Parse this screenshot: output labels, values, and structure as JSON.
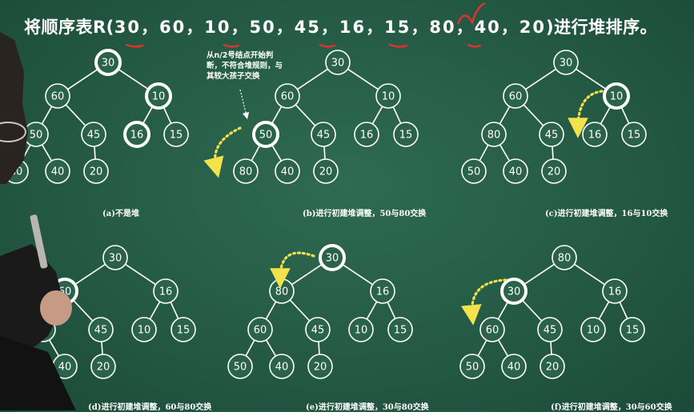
{
  "title": {
    "prefix": "将顺序表R(",
    "sequence": "30，60，10，50，45，16，15，80，40，20",
    "suffix": ")进行堆排序。"
  },
  "annotation_note": "从n/2号结点开始判断，不符合堆规则，与其较大孩子交换",
  "colors": {
    "board": "#245a45",
    "chalk": "#ffffff",
    "arrow": "#f2e34a",
    "underline": "#e0322f"
  },
  "trees": [
    {
      "id": "a",
      "caption": "(a)不是堆",
      "nodes": [
        "30",
        "60",
        "10",
        "50",
        "45",
        "16",
        "15",
        "80",
        "40",
        "20"
      ],
      "highlight": [
        0,
        2,
        5
      ]
    },
    {
      "id": "b",
      "caption": "(b)进行初建堆调整，50与80交换",
      "nodes": [
        "30",
        "60",
        "10",
        "50",
        "45",
        "16",
        "15",
        "80",
        "40",
        "20"
      ],
      "highlight": [
        3
      ]
    },
    {
      "id": "c",
      "caption": "(c)进行初建堆调整，16与10交换",
      "nodes": [
        "30",
        "60",
        "10",
        "80",
        "45",
        "16",
        "15",
        "50",
        "40",
        "20"
      ],
      "highlight": [
        2
      ]
    },
    {
      "id": "d",
      "caption": "(d)进行初建堆调整，60与80交换",
      "nodes": [
        "30",
        "60",
        "16",
        "80",
        "45",
        "10",
        "15",
        "50",
        "40",
        "20"
      ],
      "highlight": [
        1
      ]
    },
    {
      "id": "e",
      "caption": "(e)进行初建堆调整，30与80交换",
      "nodes": [
        "30",
        "80",
        "16",
        "60",
        "45",
        "10",
        "15",
        "50",
        "40",
        "20"
      ],
      "highlight": [
        0
      ]
    },
    {
      "id": "f",
      "caption": "(f)进行初建堆调整，30与60交换",
      "nodes": [
        "80",
        "30",
        "16",
        "60",
        "45",
        "10",
        "15",
        "50",
        "40",
        "20"
      ],
      "highlight": [
        1
      ]
    }
  ]
}
